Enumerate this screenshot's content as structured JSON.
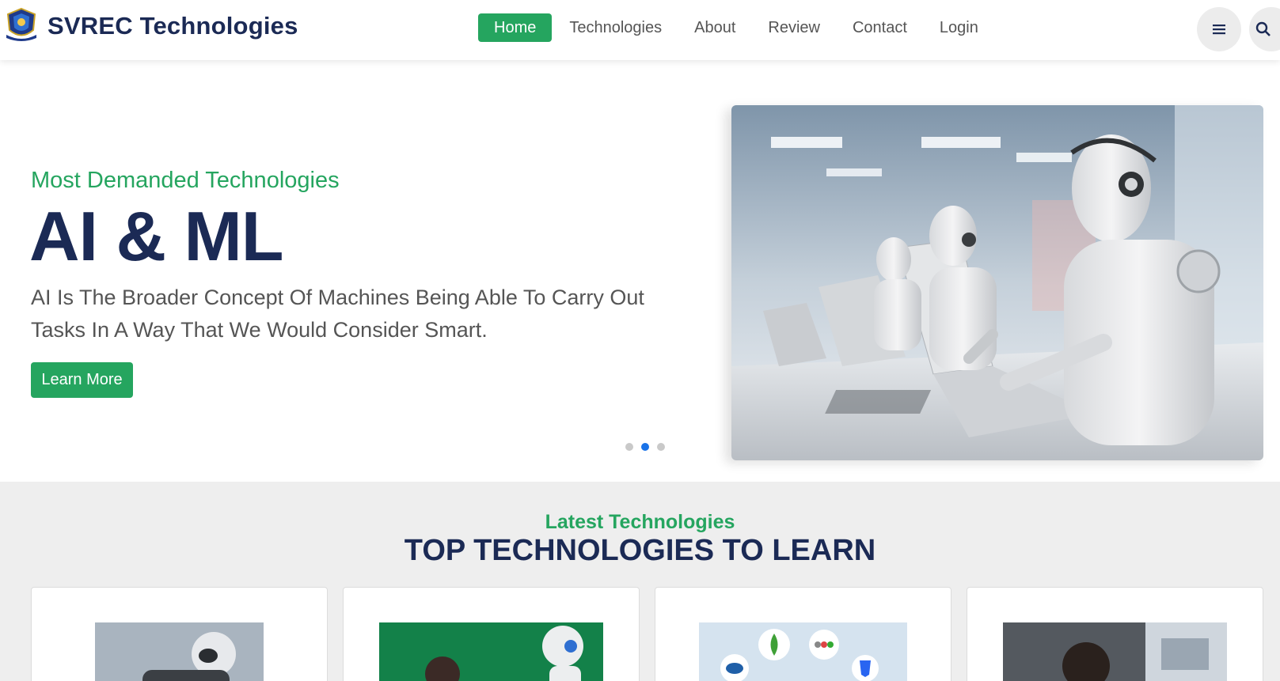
{
  "brand": {
    "name": "SVREC Technologies",
    "logo_icon": "college-crest-icon"
  },
  "nav": {
    "items": [
      {
        "label": "Home",
        "active": true
      },
      {
        "label": "Technologies",
        "active": false
      },
      {
        "label": "About",
        "active": false
      },
      {
        "label": "Review",
        "active": false
      },
      {
        "label": "Contact",
        "active": false
      },
      {
        "label": "Login",
        "active": false
      }
    ],
    "menu_icon": "hamburger-icon",
    "search_icon": "search-icon"
  },
  "hero": {
    "subtitle": "Most Demanded Technologies",
    "title": "AI & ML",
    "description": "AI Is The Broader Concept Of Machines Being Able To Carry Out Tasks In A Way That We Would Consider Smart.",
    "button_label": "Learn More",
    "carousel": {
      "slides": 3,
      "active_index": 1
    },
    "image": "robots-at-laptops-photo"
  },
  "technologies": {
    "subtitle": "Latest Technologies",
    "title": "TOP TECHNOLOGIES TO LEARN",
    "cards": [
      {
        "image": "robot-photo"
      },
      {
        "image": "person-with-robot-photo"
      },
      {
        "image": "mern-stack-logos-photo"
      },
      {
        "image": "office-worker-photo"
      }
    ]
  },
  "colors": {
    "accent": "#25a55f",
    "navy": "#1b2a55",
    "dot_active": "#1a73e8"
  }
}
